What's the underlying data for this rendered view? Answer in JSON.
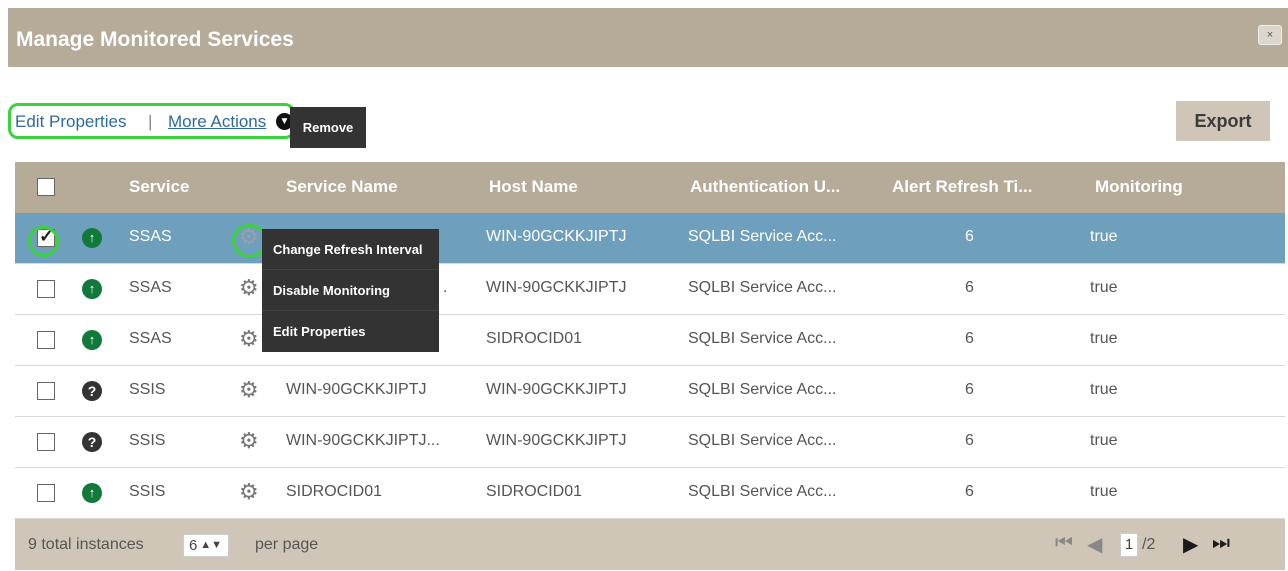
{
  "dialog": {
    "title": "Manage Monitored Services",
    "close_icon": "×"
  },
  "toolbar": {
    "edit_label": "Edit Properties",
    "separator": "|",
    "more_label": "More Actions",
    "more_icon": "▼",
    "remove_label": "Remove",
    "export_label": "Export"
  },
  "table": {
    "headers": [
      "Service",
      "Service Name",
      "Host Name",
      "Authentication U...",
      "Alert Refresh Ti...",
      "Monitoring"
    ],
    "rows": [
      {
        "service": "SSAS",
        "status": "up",
        "status_icon": "↑",
        "service_name": "",
        "host": "WIN-90GCKKJIPTJ",
        "auth": "SQLBI Service Acc...",
        "refresh": "6",
        "monitoring": "true",
        "checked": true
      },
      {
        "service": "SSAS",
        "status": "up",
        "status_icon": "↑",
        "service_name": ".",
        "host": "WIN-90GCKKJIPTJ",
        "auth": "SQLBI Service Acc...",
        "refresh": "6",
        "monitoring": "true",
        "checked": false
      },
      {
        "service": "SSAS",
        "status": "up",
        "status_icon": "↑",
        "service_name": "",
        "host": "SIDROCID01",
        "auth": "SQLBI Service Acc...",
        "refresh": "6",
        "monitoring": "true",
        "checked": false
      },
      {
        "service": "SSIS",
        "status": "unknown",
        "status_icon": "?",
        "service_name": "WIN-90GCKKJIPTJ",
        "host": "WIN-90GCKKJIPTJ",
        "auth": "SQLBI Service Acc...",
        "refresh": "6",
        "monitoring": "true",
        "checked": false
      },
      {
        "service": "SSIS",
        "status": "unknown",
        "status_icon": "?",
        "service_name": "WIN-90GCKKJIPTJ...",
        "host": "WIN-90GCKKJIPTJ",
        "auth": "SQLBI Service Acc...",
        "refresh": "6",
        "monitoring": "true",
        "checked": false
      },
      {
        "service": "SSIS",
        "status": "up",
        "status_icon": "↑",
        "service_name": "SIDROCID01",
        "host": "SIDROCID01",
        "auth": "SQLBI Service Acc...",
        "refresh": "6",
        "monitoring": "true",
        "checked": false
      }
    ]
  },
  "context_menu": {
    "items": [
      "Change Refresh Interval",
      "Disable Monitoring",
      "Edit Properties"
    ]
  },
  "footer": {
    "total_text": "9 total instances",
    "per_page_value": "6",
    "per_page_label": "per page",
    "page_current": "1",
    "page_total": "/2",
    "first_icon": "⏮",
    "prev_icon": "◀",
    "next_icon": "▶",
    "last_icon": "⏭"
  },
  "colors": {
    "title_bar": "#b6aa99",
    "selected_row": "#6e9fbd",
    "highlight_ring": "#39d33b",
    "status_up": "#117a3b",
    "footer_bg": "#cfc6b7"
  }
}
